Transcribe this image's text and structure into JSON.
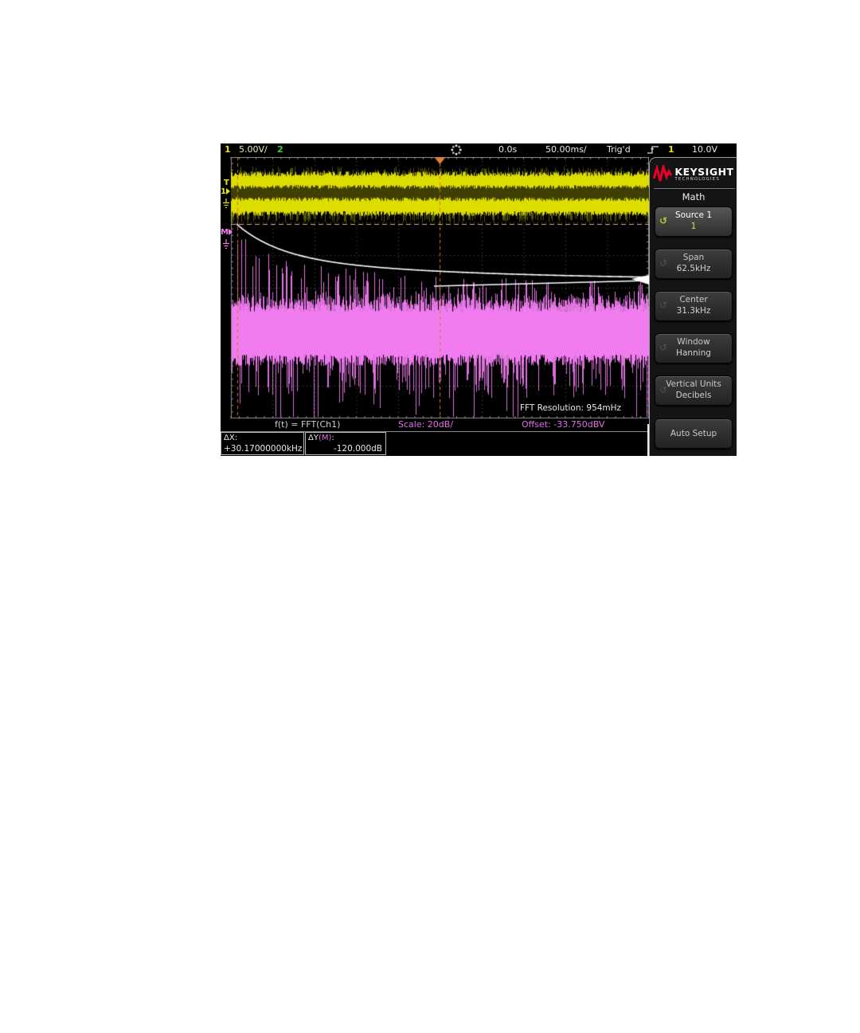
{
  "status_bar": {
    "ch1_number": "1",
    "ch1_scale": "5.00V/",
    "ch2_number": "2",
    "delay": "0.0s",
    "timebase": "50.00ms/",
    "trigger_status": "Trig'd",
    "trigger_source": "1",
    "trigger_level": "10.0V"
  },
  "branding": {
    "name": "KEYSIGHT",
    "sub": "TECHNOLOGIES"
  },
  "menu": {
    "title": "Math",
    "buttons": [
      {
        "label": "Source 1",
        "value": "1"
      },
      {
        "label": "Span",
        "value": "62.5kHz"
      },
      {
        "label": "Center",
        "value": "31.3kHz"
      },
      {
        "label": "Window",
        "value": "Hanning"
      },
      {
        "label": "Vertical Units",
        "value": "Decibels"
      },
      {
        "label": "Auto Setup",
        "value": ""
      }
    ]
  },
  "display": {
    "fft_resolution": "FFT Resolution: 954mHz",
    "function_label": "f(t) = FFT(Ch1)",
    "scale_label": "Scale: 20dB/",
    "offset_label": "Offset: -33.750dBV",
    "markers": {
      "trigger": "T",
      "ch1": "1",
      "math": "M"
    }
  },
  "cursors": {
    "dx_label": "ΔX:",
    "dx_value": "+30.17000000kHz",
    "dy_label_pre": "ΔY",
    "dy_label_src": "(M)",
    "dy_label_colon": ":",
    "dy_value": "-120.000dB"
  },
  "colors": {
    "ch1_yellow": "#e6e600",
    "ch1_dim": "#3f3f00",
    "fft_magenta": "#f07cf0",
    "magenta_text": "#e070e0",
    "cursor_orange": "#d4751e",
    "cursor_tan": "#d8b080",
    "trace_white": "#ffffff",
    "ch2_green": "#3ecf3e",
    "logo_red": "#e90029",
    "grid_gray": "#5a5a5a"
  }
}
